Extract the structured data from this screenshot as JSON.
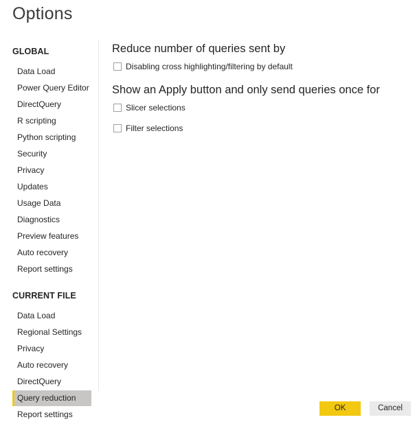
{
  "window": {
    "title": "Options"
  },
  "sidebar": {
    "global": {
      "heading": "GLOBAL",
      "items": [
        {
          "label": "Data Load"
        },
        {
          "label": "Power Query Editor"
        },
        {
          "label": "DirectQuery"
        },
        {
          "label": "R scripting"
        },
        {
          "label": "Python scripting"
        },
        {
          "label": "Security"
        },
        {
          "label": "Privacy"
        },
        {
          "label": "Updates"
        },
        {
          "label": "Usage Data"
        },
        {
          "label": "Diagnostics"
        },
        {
          "label": "Preview features"
        },
        {
          "label": "Auto recovery"
        },
        {
          "label": "Report settings"
        }
      ]
    },
    "current_file": {
      "heading": "CURRENT FILE",
      "items": [
        {
          "label": "Data Load"
        },
        {
          "label": "Regional Settings"
        },
        {
          "label": "Privacy"
        },
        {
          "label": "Auto recovery"
        },
        {
          "label": "DirectQuery"
        },
        {
          "label": "Query reduction",
          "selected": true
        },
        {
          "label": "Report settings"
        }
      ]
    }
  },
  "main": {
    "groups": [
      {
        "heading": "Reduce number of queries sent by",
        "options": [
          {
            "label": "Disabling cross highlighting/filtering by default",
            "checked": false
          }
        ]
      },
      {
        "heading": "Show an Apply button and only send queries once for",
        "options": [
          {
            "label": "Slicer selections",
            "checked": false
          },
          {
            "label": "Filter selections",
            "checked": false
          }
        ]
      }
    ]
  },
  "footer": {
    "ok_label": "OK",
    "cancel_label": "Cancel"
  },
  "colors": {
    "accent": "#f2c811",
    "selected_bg": "#c8c6c4",
    "cancel_bg": "#eaeaea"
  }
}
